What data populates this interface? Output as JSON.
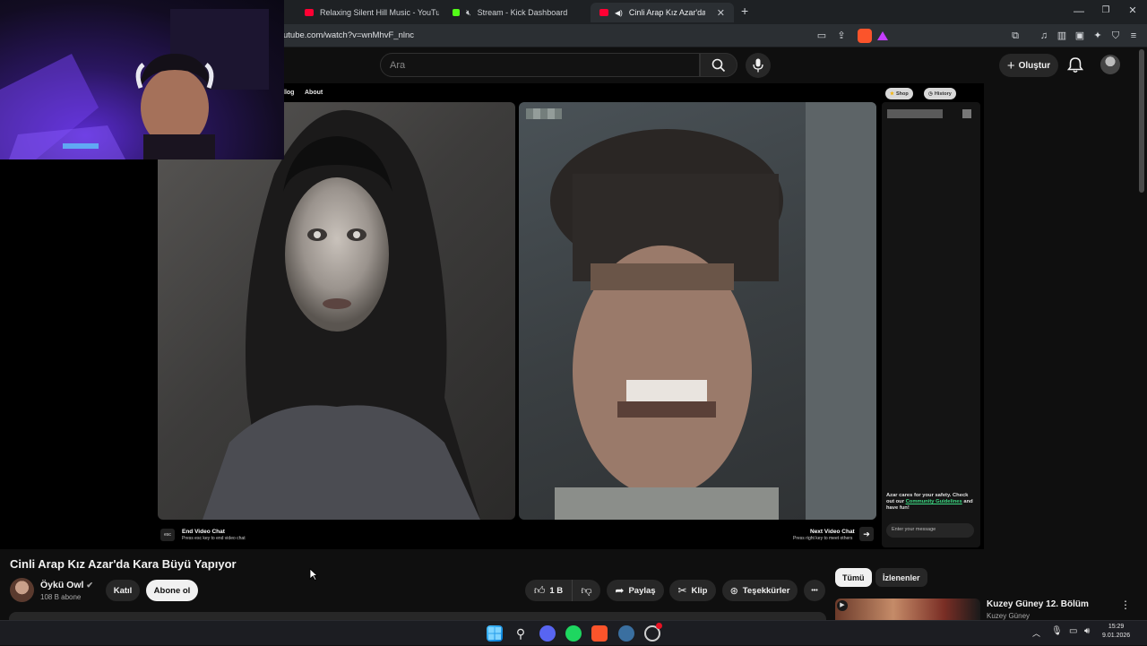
{
  "browser": {
    "tabs": [
      {
        "title": "Relaxing Silent Hill Music - YouTube",
        "icon": "youtube-icon",
        "active": false
      },
      {
        "title": "Stream - Kick Dashboard",
        "icon": "kick-icon",
        "active": false
      },
      {
        "title": "Cinli Arap Kız Azar'da Kara Bü",
        "icon": "youtube-icon",
        "active": true
      }
    ],
    "new_tab_label": "+",
    "url": "utube.com/watch?v=wnMhvF_nlnc",
    "window_controls": {
      "minimize": "—",
      "restore": "❐",
      "close": "✕"
    }
  },
  "youtube_header": {
    "search_placeholder": "Ara",
    "create_label": "Oluştur"
  },
  "video_content": {
    "links": [
      "llog",
      "About"
    ],
    "side_pills": [
      "Shop",
      "History"
    ],
    "end_chat_title": "End Video Chat",
    "end_chat_hint": "Press esc key to end video chat",
    "esc_label": "esc",
    "next_chat_title": "Next Video Chat",
    "next_chat_hint": "Press right key to meet others",
    "safety_text": "Azar cares for your safety. Check out our",
    "safety_link": "Community Guidelines",
    "safety_end": "and have fun!",
    "message_placeholder": "Enter your message"
  },
  "video_info": {
    "title": "Cinli Arap Kız Azar'da Kara Büyü Yapıyor",
    "channel_name": "Öykü Owl",
    "subscribers": "108 B abone",
    "join_label": "Katıl",
    "subscribe_label": "Abone ol",
    "like_count": "1 B",
    "share_label": "Paylaş",
    "clip_label": "Klip",
    "thanks_label": "Teşekkürler",
    "more_label": "•••"
  },
  "sidebar": {
    "chips": [
      "Tümü",
      "İzlenenler"
    ],
    "recommendation": {
      "title": "Kuzey Güney 12. Bölüm",
      "channel": "Kuzey Güney"
    }
  },
  "taskbar": {
    "time": "15:29",
    "date": "9.01.2026"
  },
  "colors": {
    "youtube_red": "#ff0033",
    "kick_green": "#53fc18",
    "background": "#0f0f0f",
    "chip_active_bg": "#f1f1f1"
  }
}
